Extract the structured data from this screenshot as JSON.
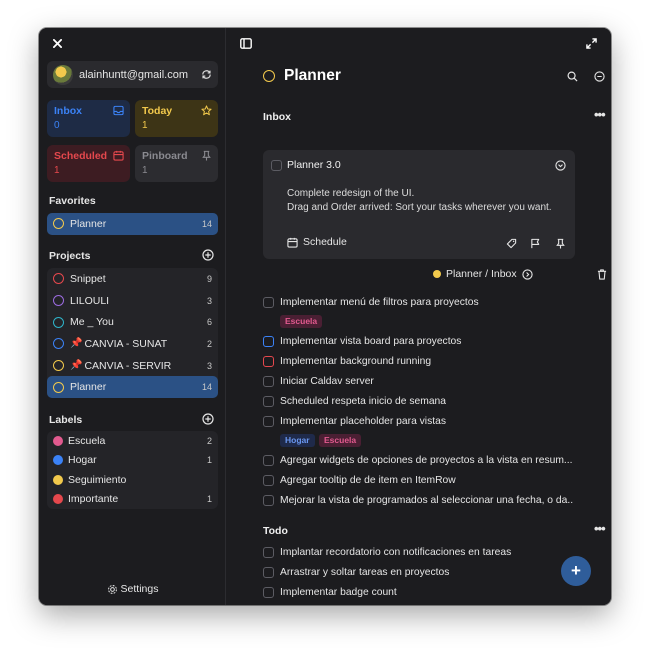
{
  "account": {
    "email": "alainhuntt@gmail.com"
  },
  "cards": {
    "inbox": {
      "label": "Inbox",
      "count": "0",
      "color": "#3b82f6"
    },
    "today": {
      "label": "Today",
      "count": "1",
      "color": "#f2c94c"
    },
    "scheduled": {
      "label": "Scheduled",
      "count": "1",
      "color": "#e5484d"
    },
    "pinboard": {
      "label": "Pinboard",
      "count": "1",
      "color": "#8a8a90"
    }
  },
  "favorites": {
    "title": "Favorites",
    "items": [
      {
        "label": "Planner",
        "count": "14",
        "color": "#f2c94c"
      }
    ]
  },
  "projects": {
    "title": "Projects",
    "items": [
      {
        "label": "Snippet",
        "count": "9",
        "color": "#e5484d"
      },
      {
        "label": "LILOULI",
        "count": "3",
        "color": "#9b6bdf"
      },
      {
        "label": "Me _ You",
        "count": "6",
        "color": "#2fb3c9"
      },
      {
        "label": "CANVIA - SUNAT",
        "count": "2",
        "color": "#3b82f6"
      },
      {
        "label": "CANVIA - SERVIR",
        "count": "3",
        "color": "#f2c94c"
      },
      {
        "label": "Planner",
        "count": "14",
        "color": "#f2c94c"
      }
    ]
  },
  "labels": {
    "title": "Labels",
    "items": [
      {
        "label": "Escuela",
        "count": "2",
        "color": "#e25a8f"
      },
      {
        "label": "Hogar",
        "count": "1",
        "color": "#3b82f6"
      },
      {
        "label": "Seguimiento",
        "count": "",
        "color": "#f2c94c"
      },
      {
        "label": "Importante",
        "count": "1",
        "color": "#e5484d"
      }
    ]
  },
  "settings_label": "Settings",
  "main": {
    "title": "Planner",
    "inbox_section": "Inbox",
    "todo_section": "Todo",
    "detail": {
      "title": "Planner 3.0",
      "notes_line1": "Complete redesign of the UI.",
      "notes_line2": "Drag and Order arrived: Sort your tasks wherever you want.",
      "schedule_label": "Schedule"
    },
    "breadcrumb": "Planner / Inbox",
    "inbox_tasks": [
      "Implementar menú de filtros para proyectos",
      "Implementar vista board para proyectos",
      "Implementar background running",
      "Iniciar Caldav server",
      "Scheduled respeta inicio de semana",
      "Implementar placeholder para vistas",
      "Agregar widgets de opciones de proyectos a la vista en resum...",
      "Agregar tooltip de de item en ItemRow",
      "Mejorar la vista de programados al seleccionar una fecha, o da..."
    ],
    "todo_tasks": [
      "Implantar recordatorio con notificaciones en tareas",
      "Arrastrar y soltar tareas en proyectos",
      "Implementar badge count"
    ],
    "tags": {
      "escuela": "Escuela",
      "hogar": "Hogar"
    }
  }
}
